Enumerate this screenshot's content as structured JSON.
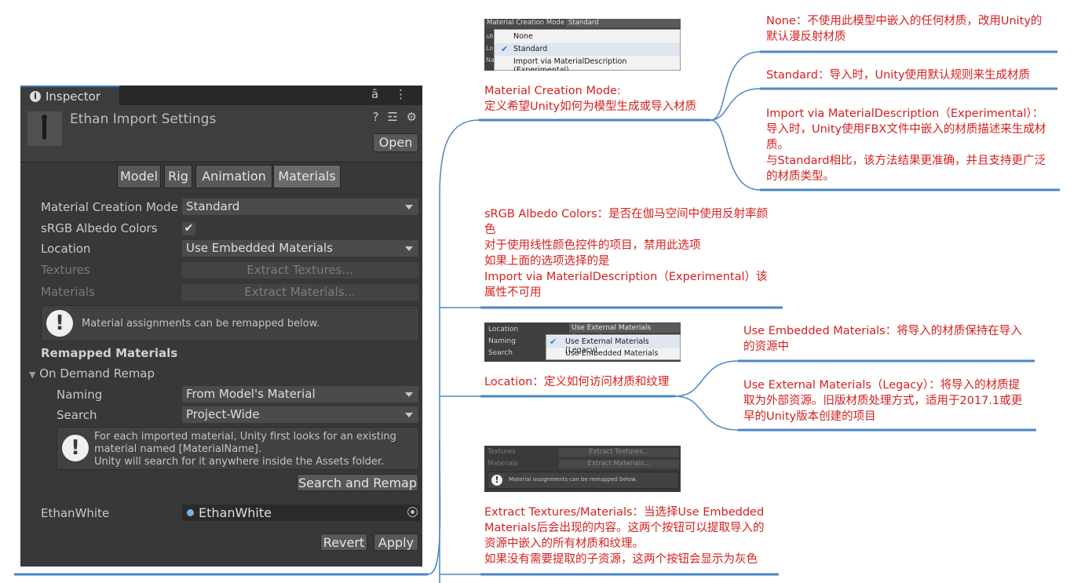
{
  "inspector": {
    "tab_label": "Inspector",
    "tab_icons": "ā ⋮",
    "title": "Ethan Import Settings",
    "header_icons": "? ☲ ⚙",
    "open_label": "Open",
    "tabs": [
      "Model",
      "Rig",
      "Animation",
      "Materials"
    ],
    "selected_tab": "Materials",
    "fields": {
      "material_creation_mode": {
        "label": "Material Creation Mode",
        "value": "Standard"
      },
      "srgb": {
        "label": "sRGB Albedo Colors",
        "checked": true
      },
      "location": {
        "label": "Location",
        "value": "Use Embedded Materials"
      },
      "textures": {
        "label": "Textures",
        "button": "Extract Textures..."
      },
      "materials": {
        "label": "Materials",
        "button": "Extract Materials..."
      }
    },
    "help1": "Material assignments can be remapped below.",
    "remapped_title": "Remapped Materials",
    "on_demand": "On Demand Remap",
    "naming": {
      "label": "Naming",
      "value": "From Model's Material"
    },
    "search": {
      "label": "Search",
      "value": "Project-Wide"
    },
    "help2": [
      "For each imported material, Unity first looks for an existing",
      "material named [MaterialName].",
      "Unity will search for it anywhere inside the Assets folder."
    ],
    "search_remap": "Search and Remap",
    "ethan_label": "EthanWhite",
    "ethan_value": "EthanWhite",
    "revert": "Revert",
    "apply": "Apply"
  },
  "shot1": {
    "header_label": "Material Creation Mode",
    "header_value": "Standard",
    "side_letters": [
      "sR",
      "Lo",
      "Na"
    ],
    "items": [
      "None",
      "Standard",
      "Import via MaterialDescription (Experimental)"
    ],
    "checked": "Standard"
  },
  "shot2": {
    "labels": [
      "Location",
      "Naming",
      "Search"
    ],
    "header_value": "Use External Materials (Legacy)",
    "items": [
      "Use External Materials (Legacy)",
      "Use Embedded Materials"
    ],
    "checked": "Use External Materials (Legacy)"
  },
  "shot3": {
    "rows": [
      {
        "label": "Textures",
        "button": "Extract Textures..."
      },
      {
        "label": "Materials",
        "button": "Extract Materials..."
      }
    ],
    "help": "Material assignments can be remapped below."
  },
  "notes": {
    "mcm": [
      "Material Creation Mode:",
      "定义希望Unity如何为模型生成或导入材质"
    ],
    "none": [
      "None：不使用此模型中嵌入的任何材质，改用Unity的",
      "默认漫反射材质"
    ],
    "standard": [
      "Standard：导入时，Unity使用默认规则来生成材质"
    ],
    "import_via": [
      "Import via MaterialDescription（Experimental）：",
      "导入时，Unity使用FBX文件中嵌入的材质描述来生成材",
      "质。",
      "与Standard相比，该方法结果更准确，并且支持更广泛",
      "的材质类型。"
    ],
    "srgb": [
      "sRGB Albedo Colors：是否在伽马空间中使用反射率颜",
      "色",
      "对于使用线性颜色控件的项目，禁用此选项",
      "如果上面的选项选择的是",
      "Import via MaterialDescription（Experimental）该",
      "属性不可用"
    ],
    "location": [
      "Location：定义如何访问材质和纹理"
    ],
    "embedded": [
      "Use Embedded Materials：将导入的材质保持在导入",
      "的资源中"
    ],
    "external": [
      "Use External Materials（Legacy）：将导入的材质提",
      "取为外部资源。旧版材质处理方式，适用于2017.1或更",
      "早的Unity版本创建的项目"
    ],
    "extract": [
      "Extract Textures/Materials：当选择Use Embedded",
      "Materials后会出现的内容。这两个按钮可以提取导入的",
      "资源中嵌入的所有材质和纹理。",
      "如果没有需要提取的子资源，这两个按钮会显示为灰色"
    ]
  },
  "colors": {
    "note_text": "#d42020",
    "connector": "#4a86c6",
    "panel_bg": "#383838"
  }
}
